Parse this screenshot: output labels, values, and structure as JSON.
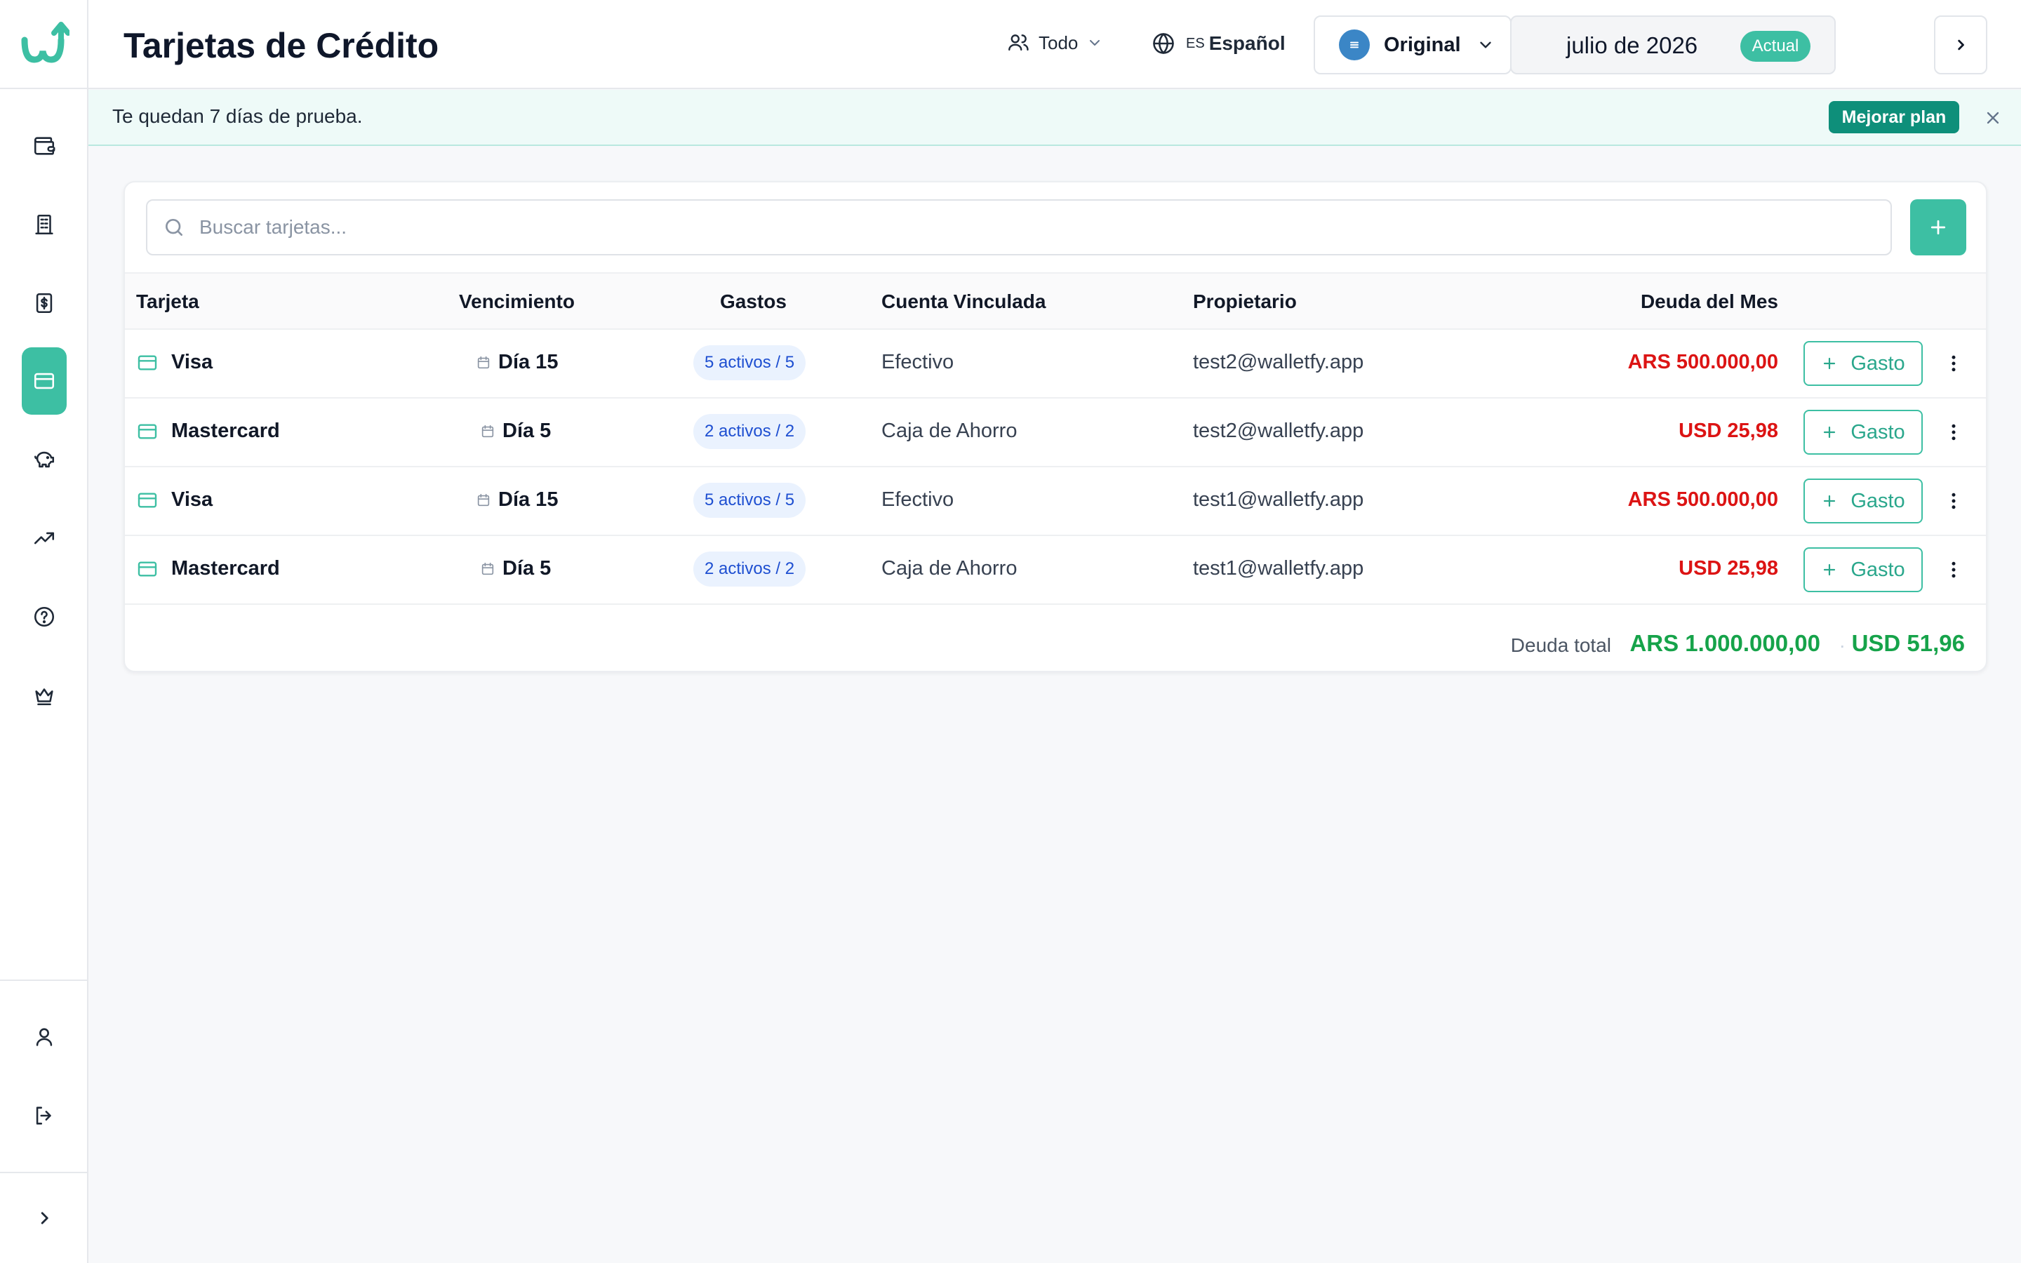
{
  "app": {
    "logo_icon": "walletfy-logo-icon",
    "accent_color": "#3dbfa3"
  },
  "sidebar": {
    "items": [
      {
        "name": "wallet-icon",
        "active": false
      },
      {
        "name": "bank-icon",
        "active": false
      },
      {
        "name": "dollar-receipt-icon",
        "active": false
      },
      {
        "name": "credit-card-icon",
        "active": true
      },
      {
        "name": "piggy-bank-icon",
        "active": false
      },
      {
        "name": "trending-up-icon",
        "active": false
      },
      {
        "name": "help-circle-icon",
        "active": false
      },
      {
        "name": "crown-icon",
        "active": false
      }
    ],
    "bottom": [
      {
        "name": "user-icon"
      },
      {
        "name": "logout-icon"
      },
      {
        "name": "chevron-right-icon"
      }
    ]
  },
  "header": {
    "title": "Tarjetas de Crédito",
    "scope_label": "Todo",
    "language_code": "ES",
    "language_label": "Español",
    "view_label": "Original",
    "month_label": "julio de 2026",
    "current_badge": "Actual"
  },
  "banner": {
    "text": "Te quedan 7 días de prueba.",
    "upgrade_label": "Mejorar plan"
  },
  "search": {
    "placeholder": "Buscar tarjetas..."
  },
  "table": {
    "columns": {
      "card": "Tarjeta",
      "due": "Vencimiento",
      "expenses": "Gastos",
      "account": "Cuenta Vinculada",
      "owner": "Propietario",
      "debt": "Deuda del Mes"
    },
    "add_expense_label": "Gasto",
    "rows": [
      {
        "card": "Visa",
        "due": "Día 15",
        "expenses": "5 activos / 5",
        "account": "Efectivo",
        "owner": "test2@walletfy.app",
        "debt": "ARS 500.000,00"
      },
      {
        "card": "Mastercard",
        "due": "Día 5",
        "expenses": "2 activos / 2",
        "account": "Caja de Ahorro",
        "owner": "test2@walletfy.app",
        "debt": "USD 25,98"
      },
      {
        "card": "Visa",
        "due": "Día 15",
        "expenses": "5 activos / 5",
        "account": "Efectivo",
        "owner": "test1@walletfy.app",
        "debt": "ARS 500.000,00"
      },
      {
        "card": "Mastercard",
        "due": "Día 5",
        "expenses": "2 activos / 2",
        "account": "Caja de Ahorro",
        "owner": "test1@walletfy.app",
        "debt": "USD 25,98"
      }
    ],
    "total_label": "Deuda total",
    "total_ars": "ARS 1.000.000,00",
    "total_separator": "·",
    "total_usd": "USD 51,96",
    "debt_color": "#dc1414",
    "total_color": "#16a34a"
  }
}
